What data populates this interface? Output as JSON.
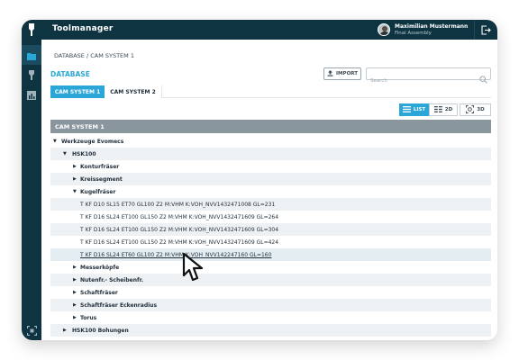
{
  "header": {
    "app_title": "Toolmanager",
    "user_name": "Maximilian  Mustermann",
    "user_role": "Final Assembly"
  },
  "breadcrumb": "DATABASE / CAM SYSTEM 1",
  "database_label": "DATABASE",
  "import_label": "IMPORT",
  "search": {
    "placeholder": "Search",
    "value": ""
  },
  "tabs": [
    {
      "label": "CAM SYSTEM 1",
      "active": true
    },
    {
      "label": "CAM SYSTEM 2",
      "active": false
    }
  ],
  "view_toggles": [
    {
      "label": "LIST",
      "active": true
    },
    {
      "label": "2D",
      "active": false
    },
    {
      "label": "3D",
      "active": false
    }
  ],
  "panel_title": "CAM SYSTEM 1",
  "tree": [
    {
      "label": "Werkzeuge Evomecs",
      "level": 0,
      "expanded": true,
      "folder": true
    },
    {
      "label": "HSK100",
      "level": 1,
      "expanded": true,
      "folder": true
    },
    {
      "label": "Konturfräser",
      "level": 2,
      "expanded": false,
      "folder": true
    },
    {
      "label": "Kreissegment",
      "level": 2,
      "expanded": false,
      "folder": true
    },
    {
      "label": "Kugelfräser",
      "level": 2,
      "expanded": true,
      "folder": true
    },
    {
      "label": "T KF D10 SL15 ET70 GL100 Z2 M:VHM K:VOH_NVV1432471008 GL=231",
      "level": 3,
      "folder": false
    },
    {
      "label": "T KF D16 SL24 ET100 GL150 Z2 M:VHM K:VOH_NVV1432471609 GL=264",
      "level": 3,
      "folder": false
    },
    {
      "label": "T KF D16 SL24 ET100 GL150 Z2 M:VHM K:VOH_NVV1432471609 GL=304",
      "level": 3,
      "folder": false
    },
    {
      "label": "T KF D16 SL24 ET100 GL150 Z2 M:VHM K:VOH_NVV1432471609 GL=424",
      "level": 3,
      "folder": false
    },
    {
      "label": "T KF D16 SL24 ET60 GL100 Z2 M:VHM K:VOH_NVV142247160 GL=160",
      "level": 3,
      "folder": false,
      "selected": true
    },
    {
      "label": "Messerköpfe",
      "level": 2,
      "expanded": false,
      "folder": true
    },
    {
      "label": "Nutenfr.- Scheibenfr.",
      "level": 2,
      "expanded": false,
      "folder": true
    },
    {
      "label": "Schaftfräser",
      "level": 2,
      "expanded": false,
      "folder": true
    },
    {
      "label": "Schaftfräser Eckenradius",
      "level": 2,
      "expanded": false,
      "folder": true
    },
    {
      "label": "Torus",
      "level": 2,
      "expanded": false,
      "folder": true
    },
    {
      "label": "HSK100 Bohungen",
      "level": 1,
      "expanded": false,
      "folder": true
    }
  ],
  "colors": {
    "sidebar": "#0e3442",
    "accent": "#2aa7d6",
    "panel_header": "#8a969e"
  },
  "icons": {
    "sidebar": [
      "folder-icon",
      "tool-icon",
      "chart-icon",
      "scan-icon"
    ],
    "logout": "logout-icon",
    "search": "search-icon",
    "import": "upload-icon"
  }
}
